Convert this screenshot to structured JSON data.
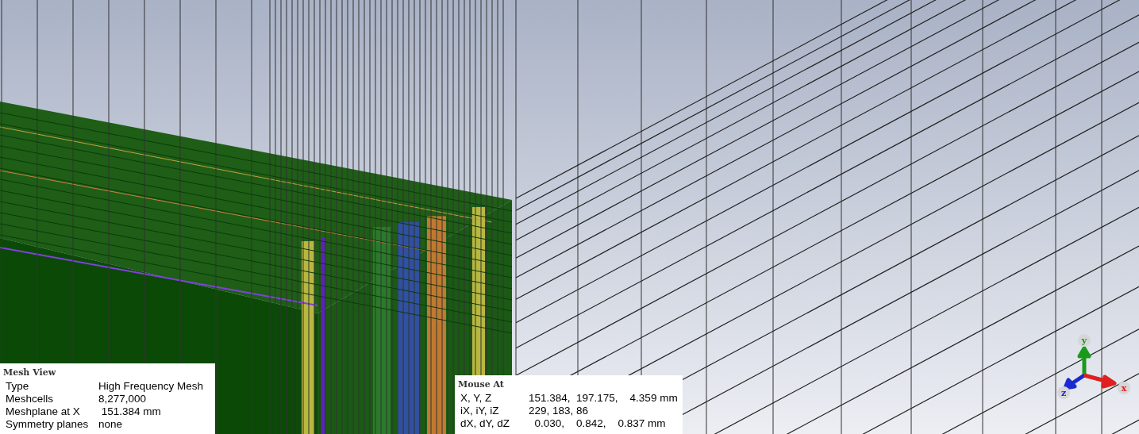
{
  "mesh_view": {
    "title": "Mesh View",
    "rows": [
      {
        "label": "Type",
        "value": "High Frequency Mesh"
      },
      {
        "label": "Meshcells",
        "value": "8,277,000"
      },
      {
        "label": "Meshplane at X",
        "value": " 151.384 mm"
      },
      {
        "label": "Symmetry planes",
        "value": "none"
      }
    ]
  },
  "mouse_at": {
    "title": "Mouse At",
    "rows": [
      {
        "label": "X, Y, Z",
        "value": "151.384,  197.175,    4.359 mm"
      },
      {
        "label": "iX, iY, iZ",
        "value": "229, 183, 86"
      },
      {
        "label": "dX, dY, dZ",
        "value": "  0.030,    0.842,    0.837 mm"
      }
    ]
  },
  "axes": [
    {
      "kind": "y",
      "label": "y",
      "color": "#1a9a1a"
    },
    {
      "kind": "z",
      "label": "z",
      "color": "#1a2ad0"
    },
    {
      "kind": "x",
      "label": "x",
      "color": "#e02020"
    }
  ]
}
